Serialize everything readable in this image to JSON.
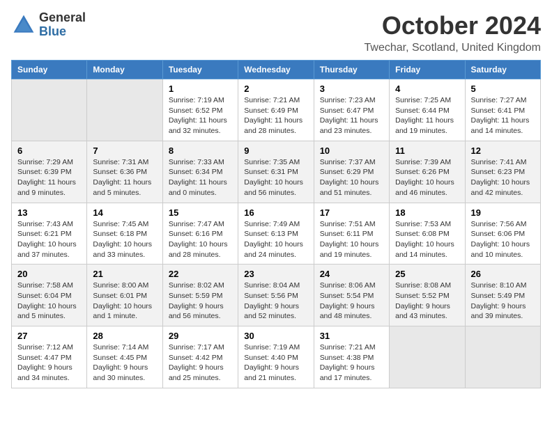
{
  "header": {
    "logo_line1": "General",
    "logo_line2": "Blue",
    "main_title": "October 2024",
    "subtitle": "Twechar, Scotland, United Kingdom"
  },
  "calendar": {
    "days_of_week": [
      "Sunday",
      "Monday",
      "Tuesday",
      "Wednesday",
      "Thursday",
      "Friday",
      "Saturday"
    ],
    "weeks": [
      [
        {
          "day": "",
          "info": ""
        },
        {
          "day": "",
          "info": ""
        },
        {
          "day": "1",
          "info": "Sunrise: 7:19 AM\nSunset: 6:52 PM\nDaylight: 11 hours\nand 32 minutes."
        },
        {
          "day": "2",
          "info": "Sunrise: 7:21 AM\nSunset: 6:49 PM\nDaylight: 11 hours\nand 28 minutes."
        },
        {
          "day": "3",
          "info": "Sunrise: 7:23 AM\nSunset: 6:47 PM\nDaylight: 11 hours\nand 23 minutes."
        },
        {
          "day": "4",
          "info": "Sunrise: 7:25 AM\nSunset: 6:44 PM\nDaylight: 11 hours\nand 19 minutes."
        },
        {
          "day": "5",
          "info": "Sunrise: 7:27 AM\nSunset: 6:41 PM\nDaylight: 11 hours\nand 14 minutes."
        }
      ],
      [
        {
          "day": "6",
          "info": "Sunrise: 7:29 AM\nSunset: 6:39 PM\nDaylight: 11 hours\nand 9 minutes."
        },
        {
          "day": "7",
          "info": "Sunrise: 7:31 AM\nSunset: 6:36 PM\nDaylight: 11 hours\nand 5 minutes."
        },
        {
          "day": "8",
          "info": "Sunrise: 7:33 AM\nSunset: 6:34 PM\nDaylight: 11 hours\nand 0 minutes."
        },
        {
          "day": "9",
          "info": "Sunrise: 7:35 AM\nSunset: 6:31 PM\nDaylight: 10 hours\nand 56 minutes."
        },
        {
          "day": "10",
          "info": "Sunrise: 7:37 AM\nSunset: 6:29 PM\nDaylight: 10 hours\nand 51 minutes."
        },
        {
          "day": "11",
          "info": "Sunrise: 7:39 AM\nSunset: 6:26 PM\nDaylight: 10 hours\nand 46 minutes."
        },
        {
          "day": "12",
          "info": "Sunrise: 7:41 AM\nSunset: 6:23 PM\nDaylight: 10 hours\nand 42 minutes."
        }
      ],
      [
        {
          "day": "13",
          "info": "Sunrise: 7:43 AM\nSunset: 6:21 PM\nDaylight: 10 hours\nand 37 minutes."
        },
        {
          "day": "14",
          "info": "Sunrise: 7:45 AM\nSunset: 6:18 PM\nDaylight: 10 hours\nand 33 minutes."
        },
        {
          "day": "15",
          "info": "Sunrise: 7:47 AM\nSunset: 6:16 PM\nDaylight: 10 hours\nand 28 minutes."
        },
        {
          "day": "16",
          "info": "Sunrise: 7:49 AM\nSunset: 6:13 PM\nDaylight: 10 hours\nand 24 minutes."
        },
        {
          "day": "17",
          "info": "Sunrise: 7:51 AM\nSunset: 6:11 PM\nDaylight: 10 hours\nand 19 minutes."
        },
        {
          "day": "18",
          "info": "Sunrise: 7:53 AM\nSunset: 6:08 PM\nDaylight: 10 hours\nand 14 minutes."
        },
        {
          "day": "19",
          "info": "Sunrise: 7:56 AM\nSunset: 6:06 PM\nDaylight: 10 hours\nand 10 minutes."
        }
      ],
      [
        {
          "day": "20",
          "info": "Sunrise: 7:58 AM\nSunset: 6:04 PM\nDaylight: 10 hours\nand 5 minutes."
        },
        {
          "day": "21",
          "info": "Sunrise: 8:00 AM\nSunset: 6:01 PM\nDaylight: 10 hours\nand 1 minute."
        },
        {
          "day": "22",
          "info": "Sunrise: 8:02 AM\nSunset: 5:59 PM\nDaylight: 9 hours\nand 56 minutes."
        },
        {
          "day": "23",
          "info": "Sunrise: 8:04 AM\nSunset: 5:56 PM\nDaylight: 9 hours\nand 52 minutes."
        },
        {
          "day": "24",
          "info": "Sunrise: 8:06 AM\nSunset: 5:54 PM\nDaylight: 9 hours\nand 48 minutes."
        },
        {
          "day": "25",
          "info": "Sunrise: 8:08 AM\nSunset: 5:52 PM\nDaylight: 9 hours\nand 43 minutes."
        },
        {
          "day": "26",
          "info": "Sunrise: 8:10 AM\nSunset: 5:49 PM\nDaylight: 9 hours\nand 39 minutes."
        }
      ],
      [
        {
          "day": "27",
          "info": "Sunrise: 7:12 AM\nSunset: 4:47 PM\nDaylight: 9 hours\nand 34 minutes."
        },
        {
          "day": "28",
          "info": "Sunrise: 7:14 AM\nSunset: 4:45 PM\nDaylight: 9 hours\nand 30 minutes."
        },
        {
          "day": "29",
          "info": "Sunrise: 7:17 AM\nSunset: 4:42 PM\nDaylight: 9 hours\nand 25 minutes."
        },
        {
          "day": "30",
          "info": "Sunrise: 7:19 AM\nSunset: 4:40 PM\nDaylight: 9 hours\nand 21 minutes."
        },
        {
          "day": "31",
          "info": "Sunrise: 7:21 AM\nSunset: 4:38 PM\nDaylight: 9 hours\nand 17 minutes."
        },
        {
          "day": "",
          "info": ""
        },
        {
          "day": "",
          "info": ""
        }
      ]
    ]
  }
}
